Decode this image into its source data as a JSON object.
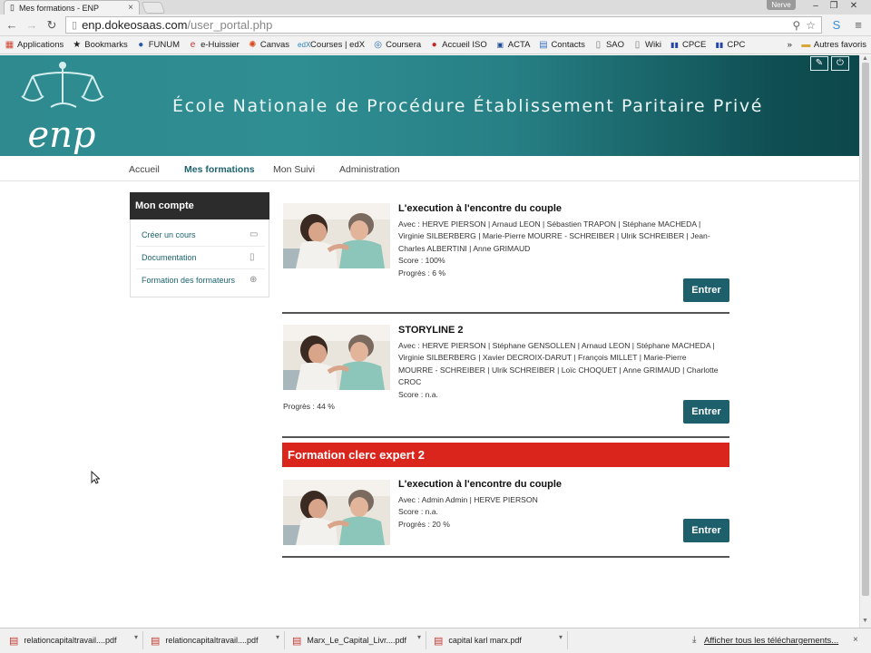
{
  "browser": {
    "tab_title": "Mes formations - ENP",
    "tab_close": "×",
    "user_badge": "Nerve",
    "window_buttons": [
      "–",
      "❐",
      "✕"
    ],
    "url_host": "enp.dokeosaas.com",
    "url_path": "/user_portal.php",
    "bookmarks": [
      {
        "label": "Applications",
        "icon": "apps-icon"
      },
      {
        "label": "Bookmarks",
        "icon": "star-icon"
      },
      {
        "label": "FUNUM",
        "icon": "funum-icon"
      },
      {
        "label": "e-Huissier",
        "icon": "e-icon"
      },
      {
        "label": "Canvas",
        "icon": "canvas-icon"
      },
      {
        "label": "Courses | edX",
        "icon": "edx-icon"
      },
      {
        "label": "Coursera",
        "icon": "coursera-icon"
      },
      {
        "label": "Accueil ISO",
        "icon": "iso-icon"
      },
      {
        "label": "ACTA",
        "icon": "acta-icon"
      },
      {
        "label": "Contacts",
        "icon": "contacts-icon"
      },
      {
        "label": "SAO",
        "icon": "page-icon"
      },
      {
        "label": "Wiki",
        "icon": "page-icon"
      },
      {
        "label": "CPCE",
        "icon": "flag-fr-icon"
      },
      {
        "label": "CPC",
        "icon": "flag-fr-icon"
      }
    ],
    "bookmarks_more": "»",
    "other_bookmarks": "Autres favoris"
  },
  "site": {
    "title": "École Nationale de Procédure Établissement Paritaire Privé",
    "logo_text": "enp",
    "nav": [
      {
        "label": "Accueil"
      },
      {
        "label": "Mes formations"
      },
      {
        "label": "Mon Suivi"
      },
      {
        "label": "Administration"
      }
    ]
  },
  "sidebar": {
    "heading": "Mon compte",
    "links": [
      {
        "label": "Créer un cours"
      },
      {
        "label": "Documentation"
      },
      {
        "label": "Formation des formateurs"
      }
    ]
  },
  "courses": [
    {
      "title": "L'execution à l'encontre du couple",
      "lines": [
        "Avec : HERVE PIERSON | Arnaud LEON | Sébastien TRAPON | Stéphane MACHEDA |",
        "Virginie SILBERBERG | Marie-Pierre MOURRE - SCHREIBER | Ulrik SCHREIBER | Jean-",
        "Charles ALBERTINI | Anne GRIMAUD",
        "Score : 100%",
        "Progrès : 6 %"
      ],
      "button": "Entrer"
    },
    {
      "title": "STORYLINE 2",
      "lines": [
        "Avec : HERVE PIERSON | Stéphane GENSOLLEN | Arnaud LEON | Stéphane MACHEDA |",
        "Virginie SILBERBERG | Xavier DECROIX-DARUT | François MILLET | Marie-Pierre",
        "MOURRE - SCHREIBER | Ulrik SCHREIBER | Loïc CHOQUET | Anne GRIMAUD | Charlotte",
        "CROC",
        "Score : n.a."
      ],
      "progress": "Progrès : 44 %",
      "button": "Entrer"
    }
  ],
  "section": {
    "title": "Formation clerc expert 2",
    "course": {
      "title": "L'execution à l'encontre du couple",
      "lines": [
        "Avec : Admin Admin | HERVE PIERSON",
        "Score : n.a.",
        "Progrès : 20 %"
      ],
      "button": "Entrer"
    }
  },
  "downloads": {
    "files": [
      "relationcapitaltravail....pdf",
      "relationcapitaltravail....pdf",
      "Marx_Le_Capital_Livr....pdf",
      "capital karl marx.pdf"
    ],
    "show_all": "Afficher tous les téléchargements...",
    "close": "×"
  },
  "colors": {
    "banner": "#2e8a8e",
    "nav_active": "#1d6470",
    "enter_button": "#1e5f6c",
    "section_red": "#d9251c"
  }
}
